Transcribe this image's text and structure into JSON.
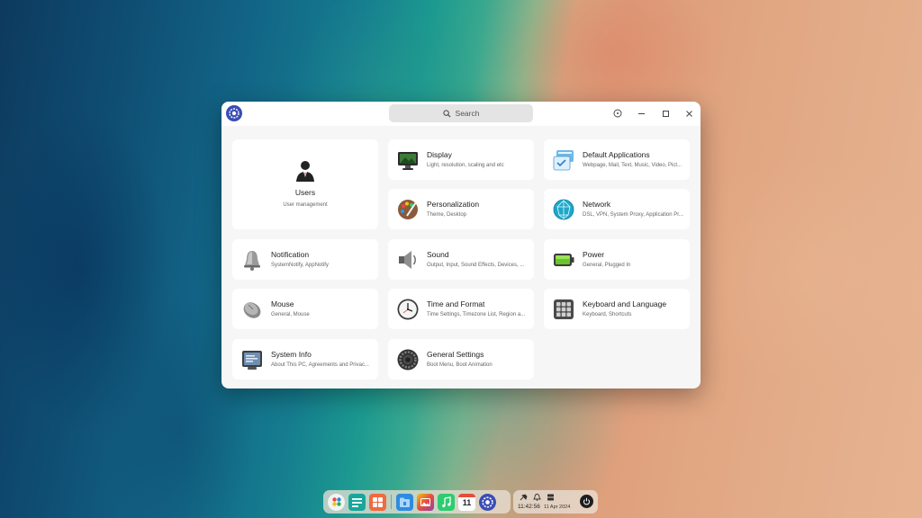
{
  "window": {
    "search_placeholder": "Search"
  },
  "modules": [
    {
      "id": "users",
      "title": "Users",
      "sub": "User management"
    },
    {
      "id": "display",
      "title": "Display",
      "sub": "Light, resolution, scaling and etc"
    },
    {
      "id": "default-applications",
      "title": "Default Applications",
      "sub": "Webpage, Mail, Text, Music, Video, Pict..."
    },
    {
      "id": "personalization",
      "title": "Personalization",
      "sub": "Theme, Desktop"
    },
    {
      "id": "network",
      "title": "Network",
      "sub": "DSL, VPN, System Proxy, Application Pr..."
    },
    {
      "id": "notification",
      "title": "Notification",
      "sub": "SystemNotify, AppNotify"
    },
    {
      "id": "sound",
      "title": "Sound",
      "sub": "Output, Input, Sound Effects, Devices, ..."
    },
    {
      "id": "power",
      "title": "Power",
      "sub": "General, Plugged In"
    },
    {
      "id": "mouse",
      "title": "Mouse",
      "sub": "General, Mouse"
    },
    {
      "id": "time-and-format",
      "title": "Time and Format",
      "sub": "Time Settings, Timezone List, Region a..."
    },
    {
      "id": "keyboard-and-language",
      "title": "Keyboard and Language",
      "sub": "Keyboard, Shortcuts"
    },
    {
      "id": "system-info",
      "title": "System Info",
      "sub": "About This PC, Agreements and Privac..."
    },
    {
      "id": "general-settings",
      "title": "General Settings",
      "sub": "Boot Menu, Boot Animation"
    }
  ],
  "dock": {
    "apps": [
      "launcher-icon",
      "multitasking-icon",
      "app-store-icon",
      "file-manager-icon",
      "image-viewer-icon",
      "music-icon",
      "calendar-icon",
      "control-center-icon"
    ],
    "calendar_day": "11"
  },
  "tray": {
    "time": "11:42:56",
    "date": "11 Apr 2024"
  }
}
